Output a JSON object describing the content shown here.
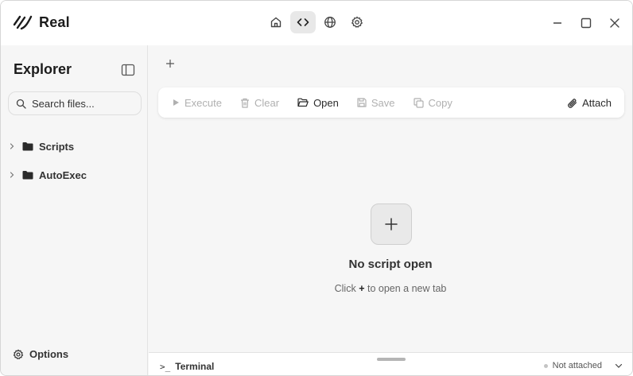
{
  "app": {
    "name": "Real"
  },
  "nav": {
    "items": [
      {
        "name": "home-icon",
        "active": false
      },
      {
        "name": "code-icon",
        "active": true
      },
      {
        "name": "globe-icon",
        "active": false
      },
      {
        "name": "settings-icon",
        "active": false
      }
    ]
  },
  "sidebar": {
    "title": "Explorer",
    "search_placeholder": "Search files...",
    "items": [
      {
        "label": "Scripts"
      },
      {
        "label": "AutoExec"
      }
    ],
    "options_label": "Options"
  },
  "toolbar": {
    "execute_label": "Execute",
    "clear_label": "Clear",
    "open_label": "Open",
    "save_label": "Save",
    "copy_label": "Copy",
    "attach_label": "Attach"
  },
  "empty_state": {
    "title": "No script open",
    "hint_prefix": "Click",
    "hint_key": "+",
    "hint_suffix": "to open a new tab"
  },
  "terminal": {
    "prompt": ">_",
    "label": "Terminal",
    "status": "Not attached"
  },
  "colors": {
    "background": "#f6f6f6",
    "surface": "#ffffff",
    "disabled_text": "#b0b0b0",
    "active_nav": "#e8e8e8"
  }
}
